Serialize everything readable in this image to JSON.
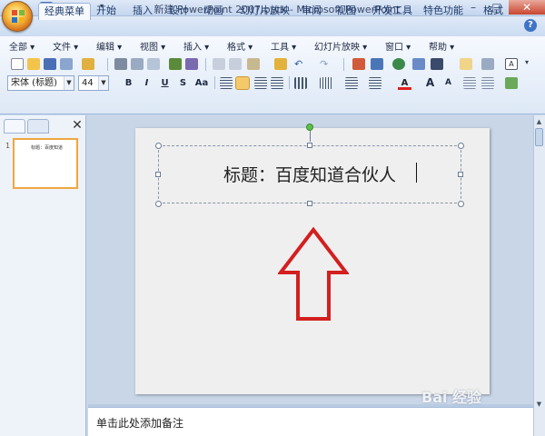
{
  "window": {
    "title": "新建 PowerPoint 2007.pptx - Microsoft PowerPoint",
    "minimize": "–",
    "maximize": "□",
    "close": "✕"
  },
  "tabs": [
    {
      "label": "经典菜单",
      "active": true
    },
    {
      "label": "开始"
    },
    {
      "label": "插入"
    },
    {
      "label": "设计"
    },
    {
      "label": "动画"
    },
    {
      "label": "幻灯片放映"
    },
    {
      "label": "审阅"
    },
    {
      "label": "视图"
    },
    {
      "label": "开发工具"
    },
    {
      "label": "特色功能"
    },
    {
      "label": "格式"
    }
  ],
  "help_label": "?",
  "menus": [
    {
      "label": "全部 ▾"
    },
    {
      "label": "文件 ▾"
    },
    {
      "label": "编辑 ▾"
    },
    {
      "label": "视图 ▾"
    },
    {
      "label": "插入 ▾"
    },
    {
      "label": "格式 ▾"
    },
    {
      "label": "工具 ▾"
    },
    {
      "label": "幻灯片放映 ▾"
    },
    {
      "label": "窗口 ▾"
    },
    {
      "label": "帮助 ▾"
    }
  ],
  "format": {
    "font_name": "宋体 (标题)",
    "font_size": "44",
    "bold": "B",
    "italic": "I",
    "underline": "U",
    "shadow": "S",
    "change_case": "Aa",
    "font_color": "A",
    "grow": "A",
    "shrink": "A"
  },
  "left_panel": {
    "close": "✕",
    "thumb_num": "1",
    "thumb_text": "标题：百度知道"
  },
  "slide": {
    "title": "标题：百度知道合伙人"
  },
  "notes": {
    "placeholder": "单击此处添加备注"
  },
  "watermark": "Bai 经验",
  "colors": {
    "arrow_stroke": "#d31f1f",
    "thumb_border": "#f0a640",
    "rotation_handle": "#5cc146"
  }
}
